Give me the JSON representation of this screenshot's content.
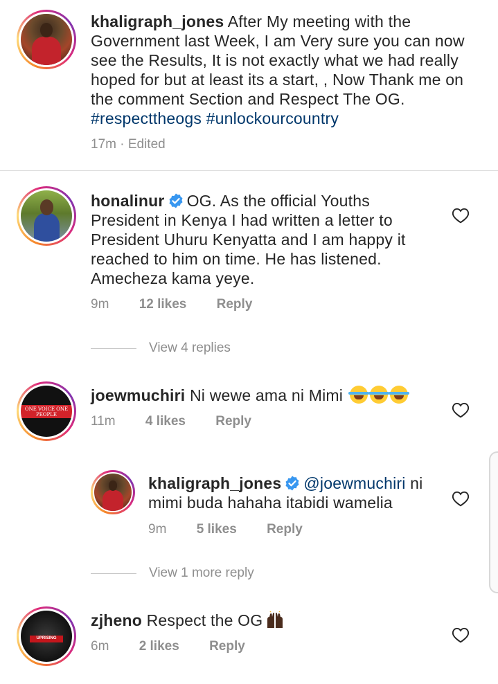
{
  "post": {
    "username": "khaligraph_jones",
    "caption_before": " After My meeting with the Government last Week, I am Very sure you can now see the Results, It is not exactly what we had really hoped for but at least its  a start, , Now Thank me on the comment Section  and Respect The OG. ",
    "hashtag1": "#respecttheogs",
    "hashtag2": "#unlockourcountry",
    "meta": "17m · Edited"
  },
  "comments": [
    {
      "username": "honalinur",
      "text": "OG. As the official Youths President in Kenya I had written a letter to President Uhuru Kenyatta and I am happy it reached to him on time. He has listened. Amecheza kama yeye.",
      "time": "9m",
      "likes": "12 likes",
      "reply": "Reply",
      "view_replies": "View 4 replies"
    },
    {
      "username": "joewmuchiri",
      "text": "Ni wewe ama ni Mimi",
      "time": "11m",
      "likes": "4 likes",
      "reply": "Reply",
      "avatar_text": "ONE VOICE ONE PEOPLE"
    },
    {
      "username": "khaligraph_jones",
      "mention": "@joewmuchiri",
      "text": " ni mimi buda hahaha itabidi wamelia",
      "time": "9m",
      "likes": "5 likes",
      "reply": "Reply",
      "view_replies": "View 1 more reply"
    },
    {
      "username": "zjheno",
      "text": "Respect the OG",
      "time": "6m",
      "likes": "2 likes",
      "reply": "Reply",
      "avatar_text": "UPRISING"
    }
  ],
  "colors": {
    "text": "#262626",
    "muted": "#8e8e8e",
    "link": "#00376b",
    "verified": "#3897f0"
  },
  "icons": {
    "like": "heart-outline-icon",
    "verified": "verified-badge-icon"
  }
}
